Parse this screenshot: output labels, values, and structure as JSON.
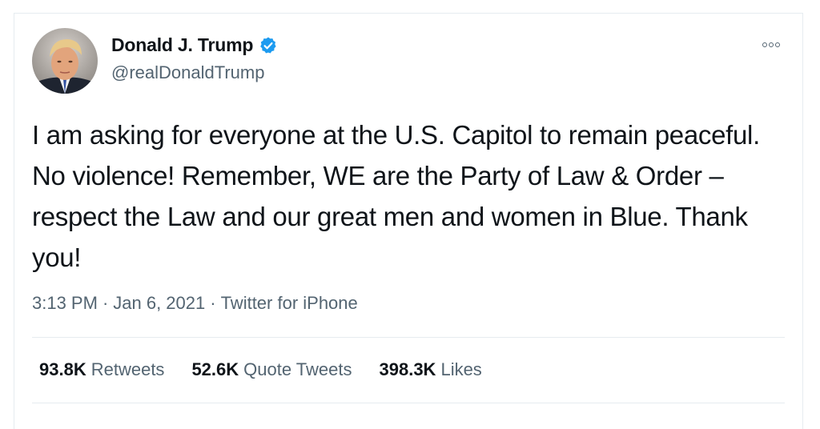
{
  "author": {
    "display_name": "Donald J. Trump",
    "handle": "@realDonaldTrump",
    "verified_icon": "verified-badge-icon",
    "avatar_icon": "profile-avatar"
  },
  "tweet": {
    "text": "I am asking for everyone at the U.S. Capitol to remain peaceful. No violence! Remember, WE are the Party of Law & Order – respect the Law and our great men and women in Blue. Thank you!",
    "time": "3:13 PM",
    "date": "Jan 6, 2021",
    "separator": "·",
    "source": "Twitter for iPhone"
  },
  "stats": {
    "retweets_count": "93.8K",
    "retweets_label": "Retweets",
    "quotes_count": "52.6K",
    "quotes_label": "Quote Tweets",
    "likes_count": "398.3K",
    "likes_label": "Likes"
  },
  "colors": {
    "primary_text": "#0f1419",
    "secondary_text": "#536471",
    "verified_blue": "#1d9bf0",
    "divider": "#e6ecf0"
  },
  "icons": {
    "more": "more-options-icon"
  }
}
